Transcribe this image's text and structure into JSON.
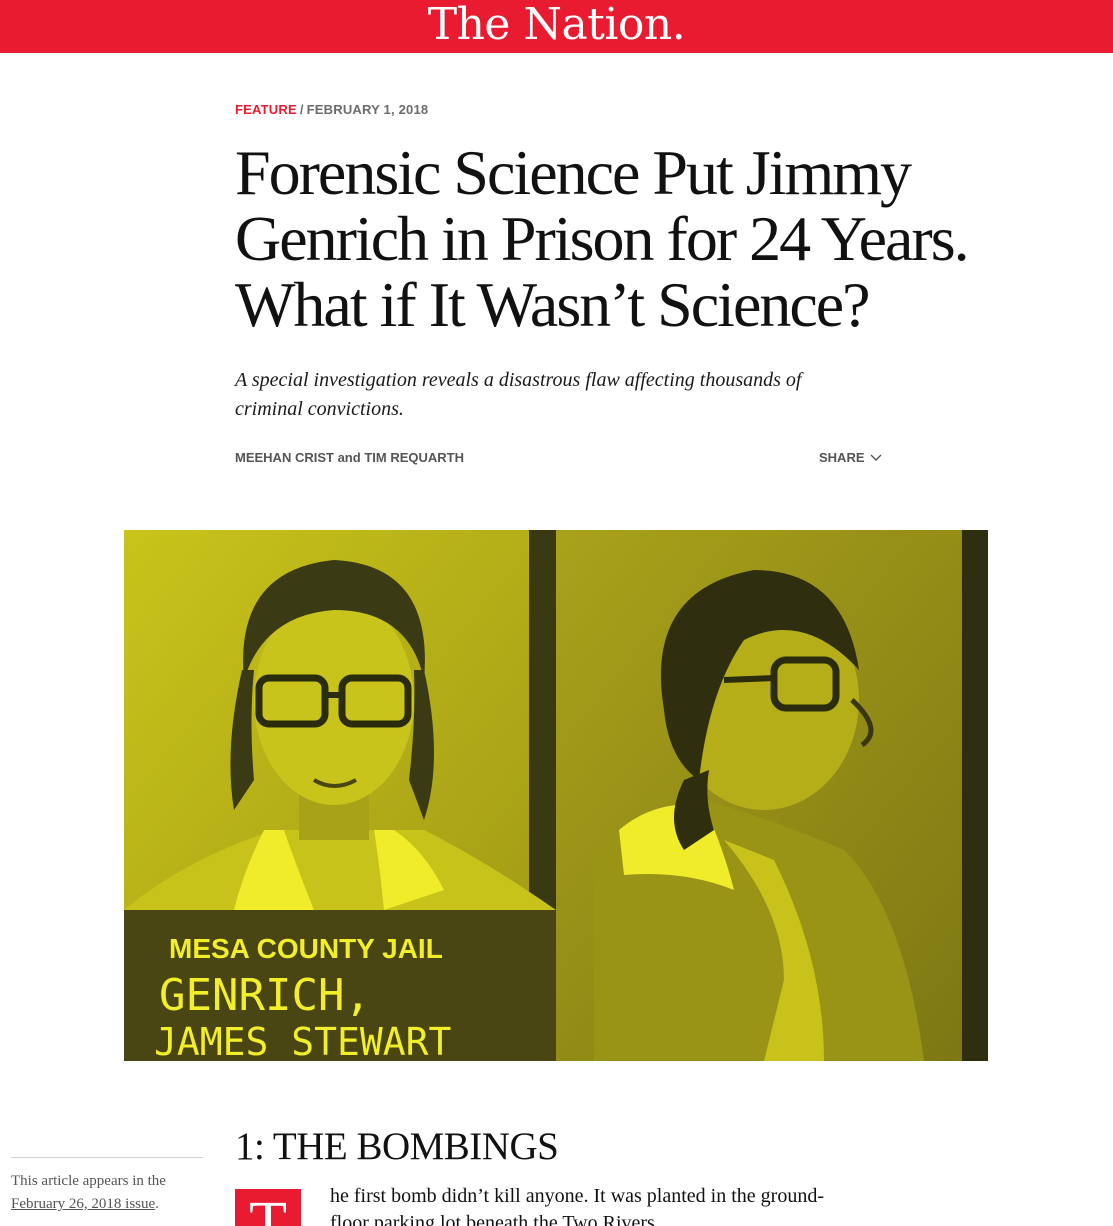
{
  "masthead": {
    "logo_text": "The Nation.",
    "brand_color": "#e81b30"
  },
  "article": {
    "section": "FEATURE",
    "separator": "/",
    "date": "FEBRUARY 1, 2018",
    "headline": "Forensic Science Put Jimmy Genrich in Prison for 24 Years. What if It Wasn’t Science?",
    "dek": "A special investigation reveals a disastrous flaw affecting thousands of criminal convictions.",
    "byline": {
      "author_1": "MEEHAN CRIST",
      "joiner": "and",
      "author_2": "TIM REQUARTH"
    },
    "share_label": "SHARE",
    "share_icon": "chevron-down-icon"
  },
  "hero_image": {
    "description": "Two yellow-tinted mugshots, front and profile",
    "sign_line_1": "MESA COUNTY JAIL",
    "sign_line_2": "GENRICH,",
    "sign_line_3": "JAMES STEWART",
    "tint_color": "#e6e619"
  },
  "sidebar": {
    "issue_prefix": "This article appears in the",
    "issue_link": "February 26, 2018 issue",
    "issue_suffix": "."
  },
  "body": {
    "section_heading": "1: THE BOMBINGS",
    "dropcap": "T",
    "first_paragraph": "he first bomb didn’t kill anyone. It was planted in the ground-floor parking lot beneath the Two Rivers"
  }
}
